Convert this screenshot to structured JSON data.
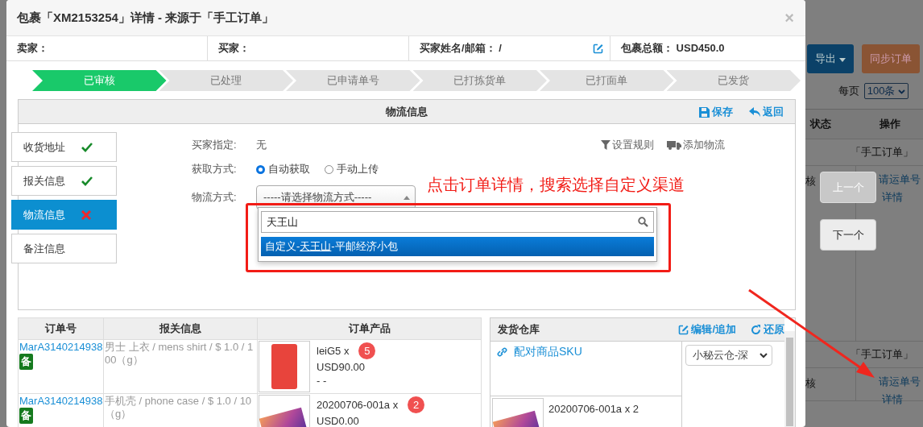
{
  "background_page": {
    "export_button": "导出",
    "sync_button": "同步订单",
    "page_size_label": "每页",
    "page_size": "100条",
    "columns": [
      "状态",
      "操作"
    ],
    "rows": [
      {
        "source": "「手工订单」",
        "status": "核",
        "actions": [
          "请运单号",
          "详情"
        ]
      },
      {
        "source": "「手工订单」",
        "status": "核",
        "actions": [
          "请运单号",
          "详情"
        ]
      }
    ]
  },
  "pager_buttons": [
    {
      "label": "上一个",
      "disabled": true
    },
    {
      "label": "下一个",
      "disabled": false
    }
  ],
  "modal": {
    "title": "包裹「XM2153254」详情 - 来源于「手工订单」",
    "close": "×",
    "info": [
      {
        "label": "卖家："
      },
      {
        "label": "买家："
      },
      {
        "label": "买家姓名/邮箱：",
        "value": "/",
        "editable": true
      },
      {
        "label": "包裹总额：",
        "value": "USD450.0"
      }
    ],
    "steps": [
      {
        "label": "已审核",
        "selected": true
      },
      {
        "label": "已处理",
        "selected": false
      },
      {
        "label": "已申请单号",
        "selected": false
      },
      {
        "label": "已打拣货单",
        "selected": false
      },
      {
        "label": "已打面单",
        "selected": false
      },
      {
        "label": "已发货",
        "selected": false
      }
    ],
    "panel": {
      "title": "物流信息",
      "save": "保存",
      "back": "返回",
      "nav": [
        {
          "label": "收货地址",
          "done": true,
          "error": false,
          "selected": false
        },
        {
          "label": "报关信息",
          "done": true,
          "error": false,
          "selected": false
        },
        {
          "label": "物流信息",
          "done": false,
          "error": true,
          "selected": true
        },
        {
          "label": "备注信息",
          "done": false,
          "error": false,
          "selected": false
        }
      ],
      "buyer_specified": {
        "label": "买家指定:",
        "value": "无"
      },
      "fetch_method": {
        "label": "获取方式:",
        "options": [
          {
            "label": "自动获取",
            "selected": true
          },
          {
            "label": "手动上传",
            "selected": false
          }
        ]
      },
      "shipping_method": {
        "label": "物流方式:",
        "placeholder": "-----请选择物流方式-----",
        "search": "天王山",
        "options": [
          {
            "before": "自定义-",
            "match": "天王山",
            "after": "-平邮经济小包",
            "selected": true
          }
        ]
      },
      "tools": [
        {
          "kind": "filter",
          "label": "设置规则"
        },
        {
          "kind": "truck",
          "label": "添加物流"
        }
      ]
    },
    "annotation": "点击订单详情，搜索选择自定义渠道",
    "order_table": {
      "columns": [
        "订单号",
        "报关信息",
        "订单产品"
      ],
      "rows": [
        {
          "order_no": "MarA3140214938",
          "tag": "备",
          "customs": "男士 上衣 / mens shirt / $ 1.0 / 100（g）",
          "product": "leiG5 x",
          "quantity": "5",
          "price": "USD90.00",
          "note": "- -"
        },
        {
          "order_no": "MarA3140214938",
          "tag": "备",
          "customs": "手机壳 / phone case / $ 1.0 / 10（g）",
          "product": "20200706-001a x",
          "quantity": "2",
          "price": "USD0.00"
        }
      ]
    },
    "warehouse": {
      "title": "发货仓库",
      "edit": "编辑/追加",
      "reset": "还原",
      "link": "配对商品SKU",
      "select": "小秘云仓-深",
      "item": "20200706-001a x 2"
    }
  }
}
